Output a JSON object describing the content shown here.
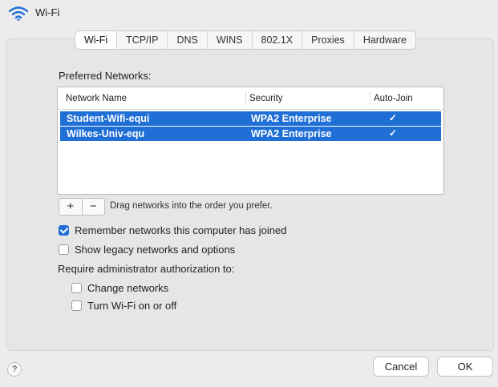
{
  "window": {
    "title": "Wi-Fi"
  },
  "tabs": [
    "Wi-Fi",
    "TCP/IP",
    "DNS",
    "WINS",
    "802.1X",
    "Proxies",
    "Hardware"
  ],
  "preferred_networks": {
    "label": "Preferred Networks:",
    "columns": {
      "name": "Network Name",
      "security": "Security",
      "auto_join": "Auto-Join"
    },
    "rows": [
      {
        "name": "Student-Wifi-equi",
        "security": "WPA2 Enterprise",
        "auto_join": "✓"
      },
      {
        "name": "Wilkes-Univ-equ",
        "security": "WPA2 Enterprise",
        "auto_join": "✓"
      }
    ]
  },
  "list_controls": {
    "add": "+",
    "remove": "−",
    "hint": "Drag networks into the order you prefer."
  },
  "options": {
    "remember": {
      "label": "Remember networks this computer has joined",
      "checked": true
    },
    "legacy": {
      "label": "Show legacy networks and options",
      "checked": false
    }
  },
  "admin": {
    "label": "Require administrator authorization to:",
    "change_networks": {
      "label": "Change networks",
      "checked": false
    },
    "turn_wifi": {
      "label": "Turn Wi-Fi on or off",
      "checked": false
    }
  },
  "footer": {
    "help": "?",
    "cancel": "Cancel",
    "ok": "OK"
  },
  "colors": {
    "accent": "#1f6fd6"
  }
}
